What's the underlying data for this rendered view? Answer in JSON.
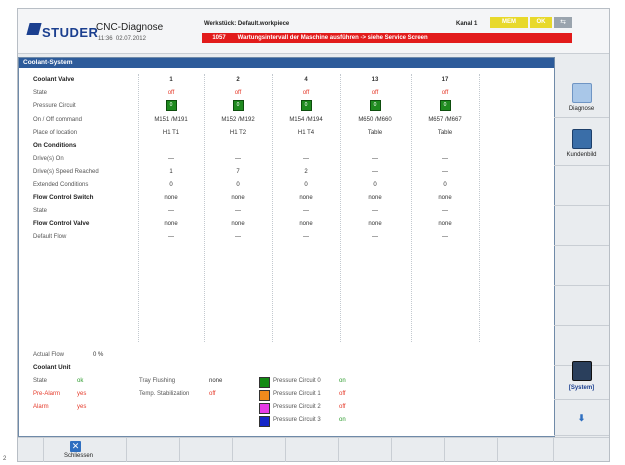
{
  "header": {
    "logo": "STUDER",
    "title": "CNC-Diagnose",
    "time": "11:36",
    "date": "02.07.2012",
    "workpiece_label": "Werkstück: Default.workpiece",
    "channel": "Kanal 1",
    "mem": "MEM",
    "ok": "OK",
    "switch_icon": "switch-icon"
  },
  "alarm": {
    "number": "1057",
    "text": "Wartungsintervall der Maschine ausführen -> siehe Service Screen",
    "color": "#e21b1b"
  },
  "panel": {
    "title": "Coolant-System",
    "columns": [
      "1",
      "2",
      "4",
      "13",
      "17"
    ],
    "rows": {
      "coolant_valve": "Coolant Valve",
      "state": "State",
      "pressure_circuit": "Pressure Circuit",
      "onoff": "On / Off command",
      "place": "Place of location",
      "on_conditions": "On Conditions",
      "drives_on": "Drive(s) On",
      "drives_speed": "Drive(s) Speed Reached",
      "extended": "Extended Conditions",
      "flow_switch": "Flow Control Switch",
      "state2": "State",
      "flow_valve": "Flow Control Valve",
      "default_flow": "Default Flow"
    },
    "values": {
      "state": [
        "off",
        "off",
        "off",
        "off",
        "off"
      ],
      "pressure": [
        "0",
        "0",
        "0",
        "0",
        "0"
      ],
      "onoff": [
        "M151 /M191",
        "M152 /M192",
        "M154 /M194",
        "M650 /M660",
        "M657 /M667"
      ],
      "place": [
        "H1 T1",
        "H1 T2",
        "H1 T4",
        "Table",
        "Table"
      ],
      "drives_on": [
        "—",
        "—",
        "—",
        "—",
        "—"
      ],
      "drives_speed": [
        "1",
        "7",
        "2",
        "—",
        "—"
      ],
      "extended": [
        "0",
        "0",
        "0",
        "0",
        "0"
      ],
      "flow_switch": [
        "none",
        "none",
        "none",
        "none",
        "none"
      ],
      "state2": [
        "—",
        "—",
        "—",
        "—",
        "—"
      ],
      "flow_valve": [
        "none",
        "none",
        "none",
        "none",
        "none"
      ],
      "default_flow": [
        "—",
        "—",
        "—",
        "—",
        "—"
      ]
    }
  },
  "bottom": {
    "actual_flow_label": "Actual Flow",
    "actual_flow_value": "0 %",
    "coolant_unit": "Coolant Unit",
    "state_label": "State",
    "state_value": "ok",
    "prealarm_label": "Pre-Alarm",
    "prealarm_value": "yes",
    "alarm_label": "Alarm",
    "alarm_value": "yes",
    "tray_label": "Tray Flushing",
    "tray_value": "none",
    "temp_label": "Temp. Stabilization",
    "temp_value": "off",
    "circuits": [
      {
        "label": "Pressure Circuit 0",
        "value": "on",
        "color": "#138a13"
      },
      {
        "label": "Pressure Circuit 1",
        "value": "off",
        "color": "#f08a1c"
      },
      {
        "label": "Pressure Circuit 2",
        "value": "off",
        "color": "#e83be8"
      },
      {
        "label": "Pressure Circuit 3",
        "value": "on",
        "color": "#1526c8"
      }
    ]
  },
  "sidebar": {
    "diagnose": "Diagnose",
    "kundenbild": "Kundenbild",
    "system": "[System]",
    "down_icon": "arrow-down-icon"
  },
  "footer": {
    "close": "Schliessen",
    "page_number": "2"
  }
}
